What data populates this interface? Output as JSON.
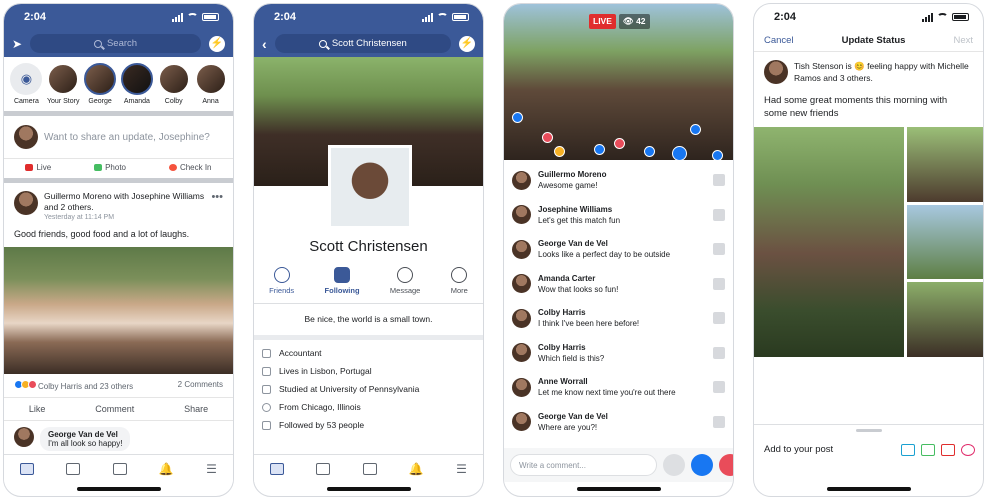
{
  "screen1": {
    "status_time": "2:04",
    "search_placeholder": "Search",
    "stories": [
      "Camera",
      "Your Story",
      "George",
      "Amanda",
      "Colby",
      "Anna"
    ],
    "composer_placeholder": "Want to share an update, Josephine?",
    "composer_actions": [
      "Live",
      "Photo",
      "Check In"
    ],
    "post": {
      "author_line": "Guillermo Moreno with Josephine Williams and 2 others.",
      "time": "Yesterday at 11:14 PM",
      "text": "Good friends, good food and a lot of laughs.",
      "reactions": "Colby Harris and 23 others",
      "comments_count": "2 Comments",
      "buttons": [
        "Like",
        "Comment",
        "Share"
      ]
    },
    "reply": {
      "name": "George Van de Vel",
      "text": "I'm all look so happy!"
    }
  },
  "screen2": {
    "status_time": "2:04",
    "search_text": "Scott Christensen",
    "name": "Scott Christensen",
    "tabs": [
      "Friends",
      "Following",
      "Message",
      "More"
    ],
    "bio": "Be nice, the world is a small town.",
    "info": [
      "Accountant",
      "Lives in Lisbon, Portugal",
      "Studied at University of Pennsylvania",
      "From Chicago, Illinois",
      "Followed by 53 people"
    ]
  },
  "screen3": {
    "live_label": "LIVE",
    "viewers": "42",
    "comments": [
      {
        "name": "Guillermo Moreno",
        "text": "Awesome game!"
      },
      {
        "name": "Josephine Williams",
        "text": "Let's get this match fun"
      },
      {
        "name": "George Van de Vel",
        "text": "Looks like a perfect day to be outside"
      },
      {
        "name": "Amanda Carter",
        "text": "Wow that looks so fun!"
      },
      {
        "name": "Colby Harris",
        "text": "I think I've been here before!"
      },
      {
        "name": "Colby Harris",
        "text": "Which field is this?"
      },
      {
        "name": "Anne Worrall",
        "text": "Let me know next time you're out there"
      },
      {
        "name": "George Van de Vel",
        "text": "Where are you?!"
      }
    ],
    "comment_placeholder": "Write a comment..."
  },
  "screen4": {
    "status_time": "2:04",
    "cancel": "Cancel",
    "title": "Update Status",
    "next": "Next",
    "author_line": "Tish Stenson is 😊 feeling happy with Michelle Ramos and 3 others.",
    "text": "Had some great moments this morning with some new friends",
    "add_to_post": "Add to your post"
  },
  "colors": {
    "fb_blue": "#3b5998",
    "live_red": "#e02d2d",
    "like_blue": "#1877f2"
  }
}
